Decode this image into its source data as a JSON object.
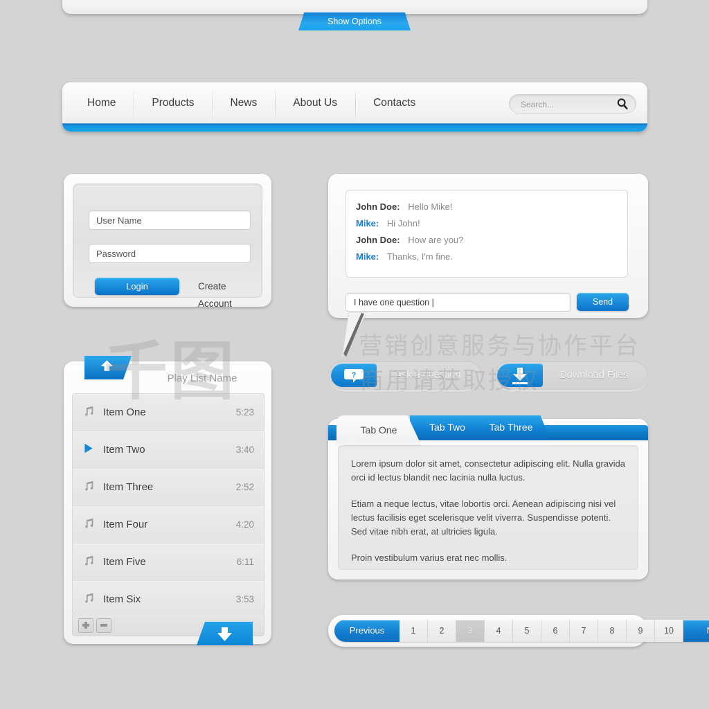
{
  "show_options": {
    "label": "Show Options"
  },
  "nav": {
    "items": [
      {
        "label": "Home"
      },
      {
        "label": "Products"
      },
      {
        "label": "News"
      },
      {
        "label": "About Us"
      },
      {
        "label": "Contacts"
      }
    ],
    "search": {
      "placeholder": "Search...",
      "value": "",
      "icon": "search-icon"
    }
  },
  "login": {
    "username": {
      "placeholder": "User Name",
      "value": ""
    },
    "password": {
      "placeholder": "Password",
      "value": ""
    },
    "login_label": "Login",
    "create_label": "Create Account"
  },
  "chat": {
    "messages": [
      {
        "name": "John Doe:",
        "text": "Hello Mike!",
        "self": false
      },
      {
        "name": "Mike:",
        "text": "Hi John!",
        "self": true
      },
      {
        "name": "John Doe:",
        "text": "How are you?",
        "self": false
      },
      {
        "name": "Mike:",
        "text": "Thanks, I'm fine.",
        "self": true
      }
    ],
    "input": {
      "value": "I have one question |",
      "placeholder": ""
    },
    "send_label": "Send"
  },
  "playlist": {
    "title": "Play List Name",
    "up_icon": "arrow-up-icon",
    "down_icon": "arrow-down-icon",
    "add_icon": "plus-icon",
    "remove_icon": "minus-icon",
    "items": [
      {
        "icon": "music-note-icon",
        "name": "Item One",
        "time": "5:23",
        "playing": false
      },
      {
        "icon": "play-icon",
        "name": "Item Two",
        "time": "3:40",
        "playing": true
      },
      {
        "icon": "music-note-icon",
        "name": "Item Three",
        "time": "2:52",
        "playing": false
      },
      {
        "icon": "music-note-icon",
        "name": "Item Four",
        "time": "4:20",
        "playing": false
      },
      {
        "icon": "music-note-icon",
        "name": "Item Five",
        "time": "6:11",
        "playing": false
      },
      {
        "icon": "music-note-icon",
        "name": "Item Six",
        "time": "3:53",
        "playing": false
      }
    ]
  },
  "actions": [
    {
      "label": "Ask a question",
      "icon": "question-bubble-icon"
    },
    {
      "label": "Download Files",
      "icon": "download-icon"
    }
  ],
  "tabs": {
    "items": [
      {
        "label": "Tab One",
        "active": true
      },
      {
        "label": "Tab Two",
        "active": false
      },
      {
        "label": "Tab Three",
        "active": false
      }
    ],
    "paragraphs": [
      "Lorem ipsum dolor sit amet, consectetur adipiscing elit. Nulla gravida orci id lectus blandit nec lacinia nulla luctus.",
      "Etiam a neque lectus, vitae lobortis orci. Aenean adipiscing nisi vel lectus facilisis eget scelerisque velit viverra. Suspendisse potenti. Sed vitae nibh erat, at ultricies ligula.",
      "Proin vestibulum varius erat nec mollis."
    ]
  },
  "pagination": {
    "previous_label": "Previous",
    "next_label": "Next",
    "pages": [
      "1",
      "2",
      "3",
      "4",
      "5",
      "6",
      "7",
      "8",
      "9",
      "10"
    ],
    "active_page": "3"
  },
  "watermark": {
    "logo": "千图",
    "line1": "营销创意服务与协作平台",
    "line2": "商用请获取授权"
  },
  "colors": {
    "accent_light": "#2ba7ec",
    "accent_dark": "#0a72c8",
    "background": "#d4d4d4",
    "panel": "#f3f3f3"
  }
}
